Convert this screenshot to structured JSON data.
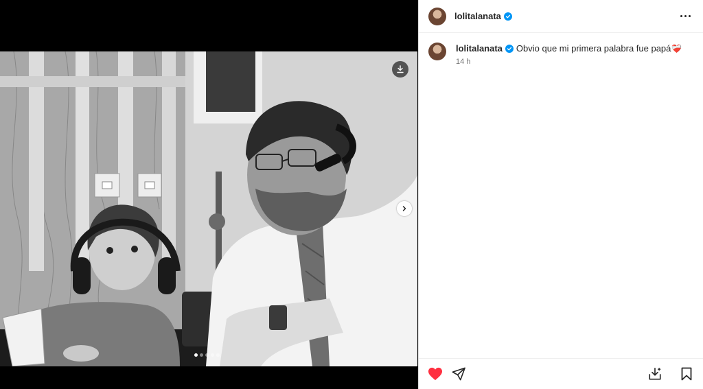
{
  "post": {
    "username": "lolitalanata",
    "verified_icon": "verified-badge-icon",
    "caption": "Obvio que mi primera palabra fue papá",
    "caption_emoji": "❤️‍🩹",
    "time_ago": "14 h",
    "liked": true,
    "carousel": {
      "total": 5,
      "current": 1
    }
  },
  "icons": {
    "like": "heart-filled-icon",
    "share": "paper-plane-icon",
    "download": "download-icon",
    "save": "bookmark-icon",
    "more": "more-horizontal-icon",
    "next": "chevron-right-icon"
  },
  "colors": {
    "like_red": "#ff3040",
    "verified_blue": "#0095f6",
    "text": "#262626",
    "muted": "#737373"
  }
}
